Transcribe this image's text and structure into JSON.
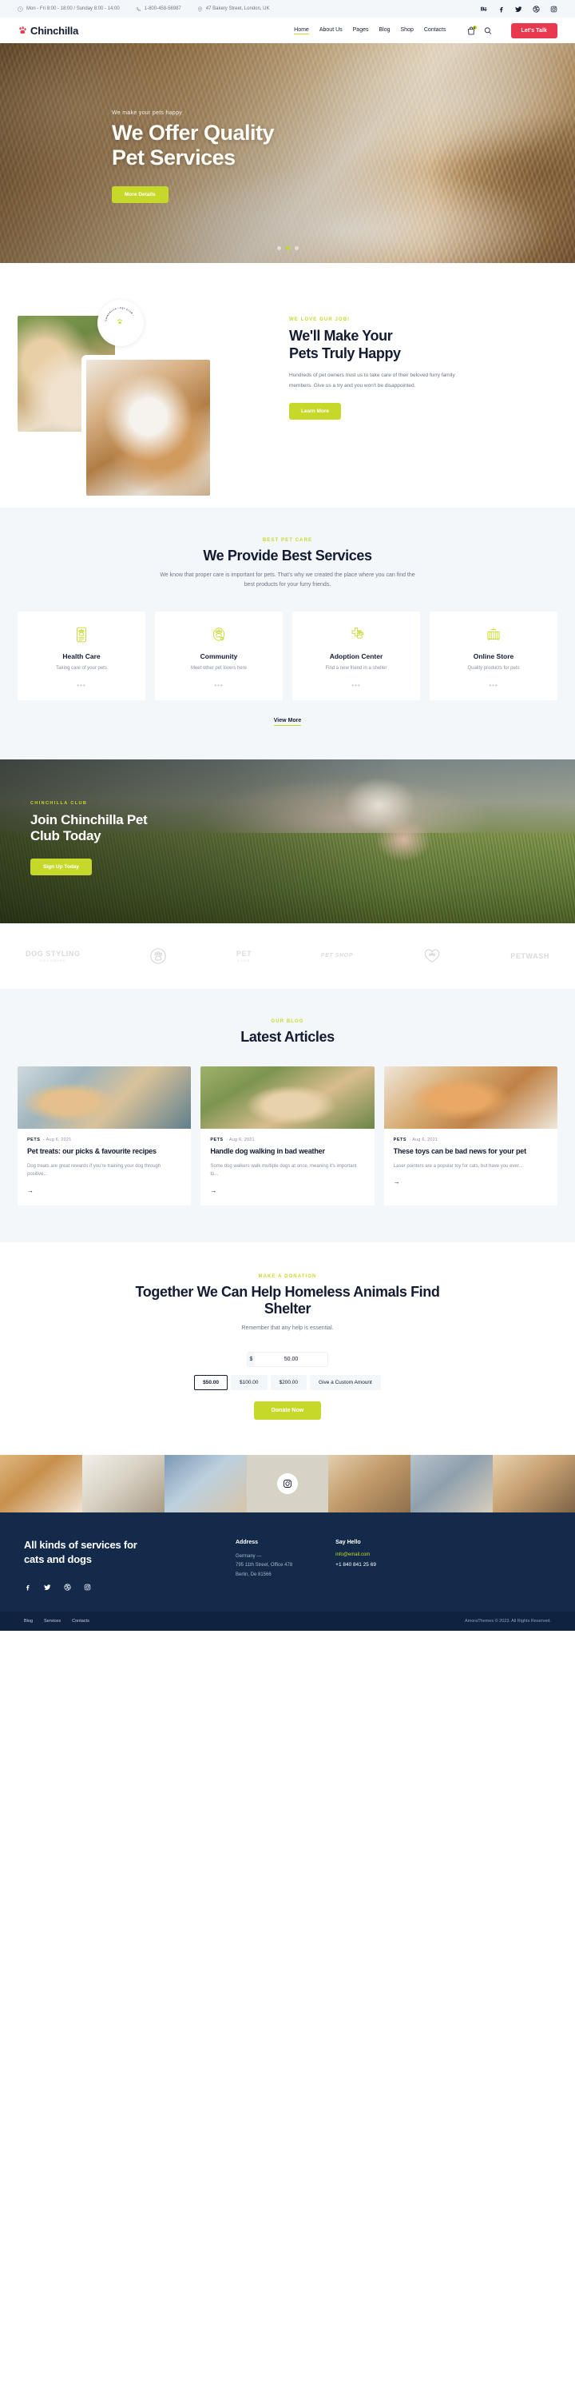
{
  "topbar": {
    "hours": "Mon - Fri 8:00 - 18:00 / Sunday 8:00 - 14:00",
    "phone": "1-800-458-56987",
    "address": "47 Bakery Street, London, UK",
    "socials": [
      "behance-icon",
      "facebook-icon",
      "twitter-icon",
      "dribbble-icon",
      "instagram-icon"
    ]
  },
  "header": {
    "brand": "Chinchilla",
    "nav": [
      {
        "label": "Home",
        "active": true
      },
      {
        "label": "About Us",
        "active": false
      },
      {
        "label": "Pages",
        "active": false
      },
      {
        "label": "Blog",
        "active": false
      },
      {
        "label": "Shop",
        "active": false
      },
      {
        "label": "Contacts",
        "active": false
      }
    ],
    "cart_count": "0",
    "cta": "Let's Talk"
  },
  "hero": {
    "eyebrow": "We make your pets happy",
    "title_line1": "We Offer Quality",
    "title_line2": "Pet Services",
    "button": "More Details",
    "slides": 3,
    "active_slide": 1
  },
  "about": {
    "eyebrow": "WE LOVE OUR JOB!",
    "title_line1": "We'll Make Your",
    "title_line2": "Pets Truly Happy",
    "text": "Hundreds of pet owners trust us to take care of their beloved furry family members. Give us a try and you won't be disappointed.",
    "button": "Learn More",
    "badge_text": "CHINCHILLA • PET CLUB •"
  },
  "services": {
    "eyebrow": "BEST PET CARE",
    "title": "We Provide Best Services",
    "subtitle": "We know that proper care is important for pets. That's why we created the place where you can find the best products for your furry friends.",
    "cards": [
      {
        "icon": "health-card-icon",
        "title": "Health Care",
        "text": "Taking care of your pets",
        "dots": "•••"
      },
      {
        "icon": "community-paw-icon",
        "title": "Community",
        "text": "Meet other pet lovers here",
        "dots": "•••"
      },
      {
        "icon": "adoption-paw-icon",
        "title": "Adoption Center",
        "text": "Find a new friend in a shelter",
        "dots": "•••"
      },
      {
        "icon": "pet-carrier-icon",
        "title": "Online Store",
        "text": "Quality products for pets",
        "dots": "•••"
      }
    ],
    "view_more": "View More"
  },
  "club": {
    "eyebrow": "CHINCHILLA CLUB",
    "title_line1": "Join Chinchilla Pet",
    "title_line2": "Club Today",
    "button": "Sign Up Today"
  },
  "brands": [
    {
      "name": "DOG STYLING",
      "sub": "GROOMING"
    },
    {
      "name": "paw-brand-icon",
      "sub": ""
    },
    {
      "name": "PET",
      "sub": "CLUB"
    },
    {
      "name": "PET SHOP",
      "sub": ""
    },
    {
      "name": "heart-brand-icon",
      "sub": ""
    },
    {
      "name": "PETWASH",
      "sub": ""
    }
  ],
  "blog": {
    "eyebrow": "OUR BLOG",
    "title": "Latest Articles",
    "posts": [
      {
        "category": "PETS",
        "date": "Aug 6, 2021",
        "title": "Pet treats: our picks & favourite recipes",
        "excerpt": "Dog treats are great rewards if you're training your dog through positive...",
        "arrow": "→"
      },
      {
        "category": "PETS",
        "date": "Aug 6, 2021",
        "title": "Handle dog walking in bad weather",
        "excerpt": "Some dog walkers walk multiple dogs at once, meaning it's important to...",
        "arrow": "→"
      },
      {
        "category": "PETS",
        "date": "Aug 6, 2021",
        "title": "These toys can be bad news for your pet",
        "excerpt": "Laser pointers are a popular toy for cats, but have you ever...",
        "arrow": "→"
      }
    ]
  },
  "donation": {
    "eyebrow": "MAKE A DONATION",
    "title_line1": "Together We Can Help Homeless",
    "title_line2": "Animals Find Shelter",
    "subtitle": "Remember that any help is essential.",
    "currency": "$",
    "amount": "50.00",
    "presets": [
      {
        "label": "$50.00",
        "selected": true
      },
      {
        "label": "$100.00",
        "selected": false
      },
      {
        "label": "$200.00",
        "selected": false
      },
      {
        "label": "Give a Custom Amount",
        "selected": false
      }
    ],
    "button": "Donate Now"
  },
  "gallery": {
    "badge_icon": "instagram-icon"
  },
  "footer": {
    "claim_line1": "All kinds of services for",
    "claim_line2": "cats and dogs",
    "address_title": "Address",
    "address_lines": [
      "Germany —",
      "795 11th Street, Office 478",
      "Berlin, De 81566"
    ],
    "contact_title": "Say Hello",
    "email": "info@email.com",
    "phone": "+1 840 841 25 69",
    "socials": [
      "facebook-icon",
      "twitter-icon",
      "dribbble-icon",
      "instagram-icon"
    ],
    "bottom_links": [
      "Blog",
      "Services",
      "Contacts"
    ],
    "copyright": "AmoraThemes © 2023. All Rights Reserved."
  },
  "colors": {
    "accent_lime": "#c6d92b",
    "accent_red": "#e8394f",
    "dark": "#141b33",
    "footer_bg": "#142a4a"
  }
}
